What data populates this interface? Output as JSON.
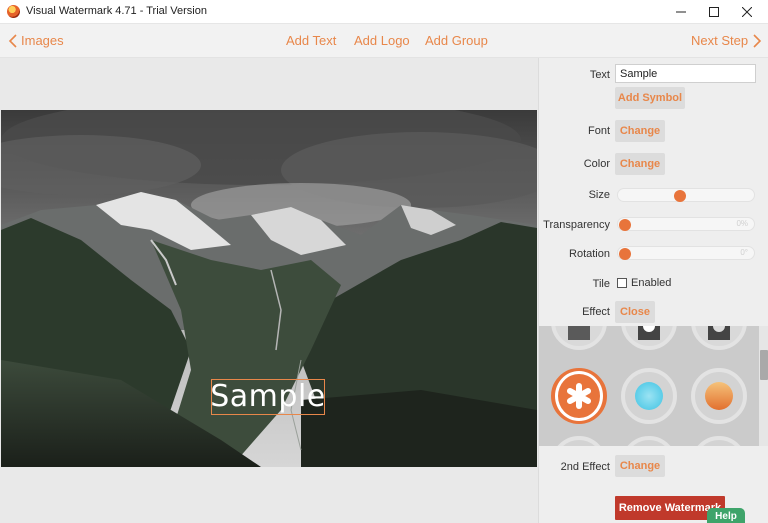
{
  "window": {
    "title": "Visual Watermark 4.71 - Trial Version"
  },
  "nav": {
    "back_label": "Images",
    "add_text": "Add Text",
    "add_logo": "Add Logo",
    "add_group": "Add Group",
    "next_label": "Next Step"
  },
  "canvas": {
    "watermark_text": "Sample"
  },
  "panel": {
    "text_label": "Text",
    "text_value": "Sample",
    "add_symbol": "Add Symbol",
    "font_label": "Font",
    "font_button": "Change",
    "color_label": "Color",
    "color_button": "Change",
    "size_label": "Size",
    "size_value": 0.45,
    "transparency_label": "Transparency",
    "transparency_value": "0%",
    "rotation_label": "Rotation",
    "rotation_value": "0°",
    "tile_label": "Tile",
    "tile_checkbox_label": "Enabled",
    "tile_checked": false,
    "effect_label": "Effect",
    "effect_button": "Close",
    "effects": [
      {
        "name": "shadow-box"
      },
      {
        "name": "shadow-box-light"
      },
      {
        "name": "shadow-box-dark"
      },
      {
        "name": "asterisk",
        "selected": true
      },
      {
        "name": "cyan-glow"
      },
      {
        "name": "orange-gradient"
      }
    ],
    "second_effect_label": "2nd Effect",
    "second_effect_button": "Change",
    "remove_watermark": "Remove Watermark",
    "help": "Help"
  },
  "colors": {
    "accent": "#e8874a",
    "knob": "#e8743b",
    "remove": "#c0392b",
    "help": "#3ea46a"
  }
}
